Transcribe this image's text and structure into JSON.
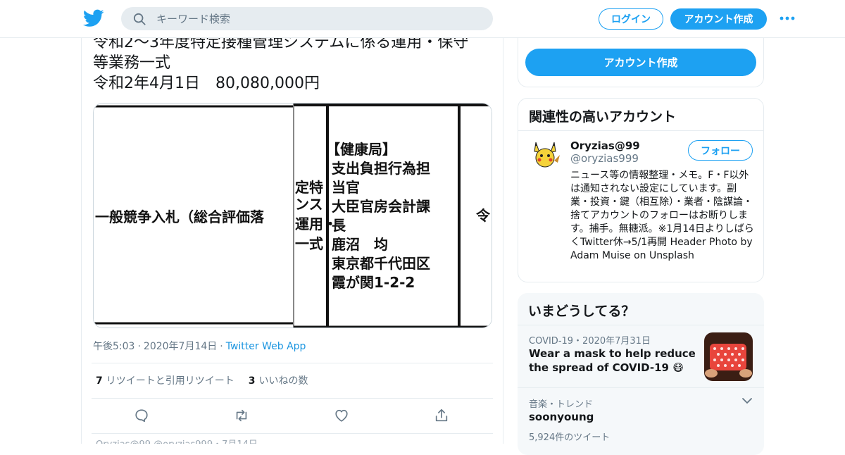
{
  "header": {
    "logo_icon": "twitter-bird-icon",
    "search_placeholder": "キーワード検索",
    "login_label": "ログイン",
    "signup_label": "アカウント作成",
    "more_icon": "more-dots-icon",
    "brand_color": "#1da1f2"
  },
  "tweet": {
    "text": "令和2～3年度特定接種管理システムに係る運用・保守\n等業務一式\n令和2年4月1日　80,080,000円",
    "media_text": {
      "left_col": "一般競争入札（総合評価落",
      "mid_col_lines": [
        "定特",
        "ンス",
        "運用・",
        "一式"
      ],
      "right_col_lines": [
        "【健康局】",
        "支出負担行為担",
        "当官",
        "大臣官房会計課",
        "長",
        "鹿沼　均",
        "東京都千代田区",
        "霞が関1-2-2"
      ],
      "far_right": "令"
    },
    "time": "午後5:03",
    "date": "2020年7月14日",
    "app": "Twitter Web App",
    "retweets_count": "7",
    "retweets_label": "リツイートと引用リツイート",
    "likes_count": "3",
    "likes_label": "いいねの数",
    "actions": [
      "reply-icon",
      "retweet-icon",
      "like-icon",
      "share-icon"
    ]
  },
  "reply_peek": "Oryzias@99 @oryzias999・7月14日",
  "sidebar": {
    "signup_button": "アカウント作成",
    "related": {
      "title": "関連性の高いアカウント",
      "account": {
        "name": "Oryzias@99",
        "handle": "@oryzias999",
        "follow_label": "フォロー",
        "bio": "ニュース等の情報整理・メモ。F・F以外は通知されない設定にしています。副業・投資・鍵（相互除）・業者・陰謀論・捨てアカウントのフォローはお断りします。捕手。無糖派。※1月14日よりしばらくTwitter休→5/1再開 Header Photo by Adam Muise on Unsplash"
      }
    },
    "trends": {
      "title": "いまどうしてる？",
      "items": [
        {
          "context": "COVID-19・2020年7月31日",
          "title": "Wear a mask to help reduce the spread of COVID-19 😷",
          "count": ""
        },
        {
          "context": "音楽・トレンド",
          "title": "soonyoung",
          "count": "5,924件のツイート"
        }
      ]
    }
  }
}
